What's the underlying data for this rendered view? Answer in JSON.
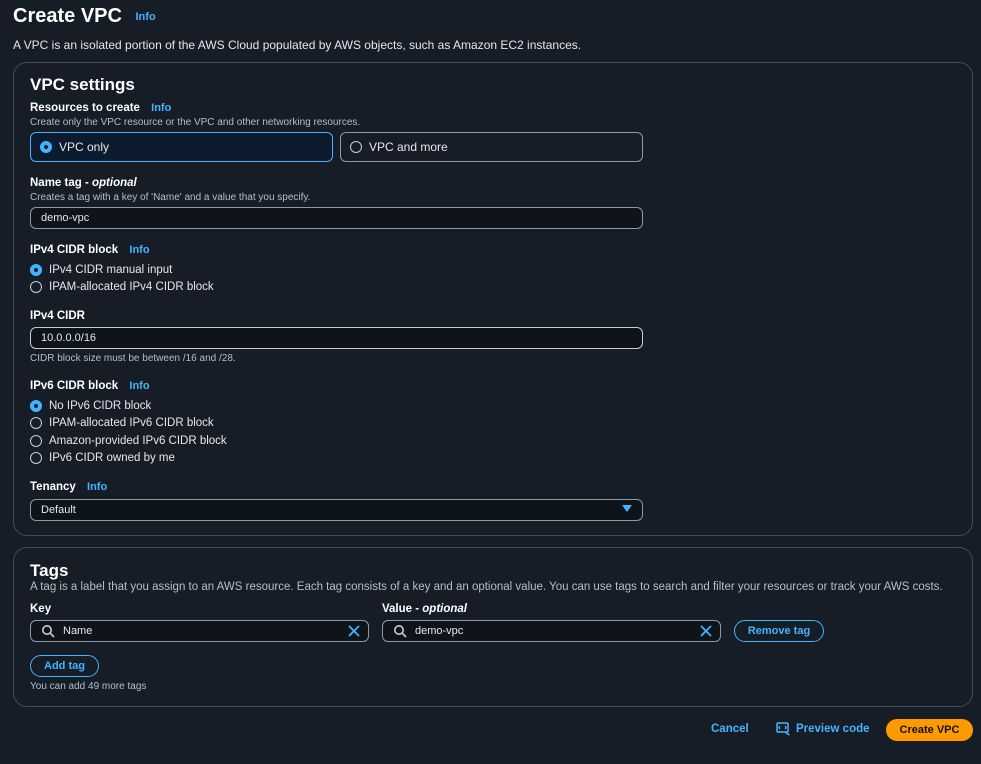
{
  "page": {
    "title": "Create VPC",
    "info": "Info",
    "description": "A VPC is an isolated portion of the AWS Cloud populated by AWS objects, such as Amazon EC2 instances."
  },
  "vpc_settings": {
    "title": "VPC settings",
    "resources": {
      "label": "Resources to create",
      "info": "Info",
      "hint": "Create only the VPC resource or the VPC and other networking resources.",
      "options": [
        "VPC only",
        "VPC and more"
      ],
      "selected": "VPC only"
    },
    "name_tag": {
      "label": "Name tag - ",
      "optional": "optional",
      "hint": "Creates a tag with a key of 'Name' and a value that you specify.",
      "value": "demo-vpc"
    },
    "ipv4_block": {
      "label": "IPv4 CIDR block",
      "info": "Info",
      "options": [
        "IPv4 CIDR manual input",
        "IPAM-allocated IPv4 CIDR block"
      ],
      "selected": "IPv4 CIDR manual input"
    },
    "ipv4_cidr": {
      "label": "IPv4 CIDR",
      "value": "10.0.0.0/16",
      "hint": "CIDR block size must be between /16 and /28."
    },
    "ipv6_block": {
      "label": "IPv6 CIDR block",
      "info": "Info",
      "options": [
        "No IPv6 CIDR block",
        "IPAM-allocated IPv6 CIDR block",
        "Amazon-provided IPv6 CIDR block",
        "IPv6 CIDR owned by me"
      ],
      "selected": "No IPv6 CIDR block"
    },
    "tenancy": {
      "label": "Tenancy",
      "info": "Info",
      "value": "Default"
    }
  },
  "tags": {
    "title": "Tags",
    "description": "A tag is a label that you assign to an AWS resource. Each tag consists of a key and an optional value. You can use tags to search and filter your resources or track your AWS costs.",
    "key_label": "Key",
    "value_label": "Value - ",
    "value_optional": "optional",
    "rows": [
      {
        "key": "Name",
        "value": "demo-vpc"
      }
    ],
    "remove_label": "Remove tag",
    "add_label": "Add tag",
    "remaining": "You can add 49 more tags"
  },
  "footer": {
    "cancel": "Cancel",
    "preview": "Preview code",
    "create": "Create VPC"
  },
  "colors": {
    "background": "#161d26",
    "accent": "#42b4ff",
    "primary": "#ff9900",
    "border": "#414d5c"
  }
}
